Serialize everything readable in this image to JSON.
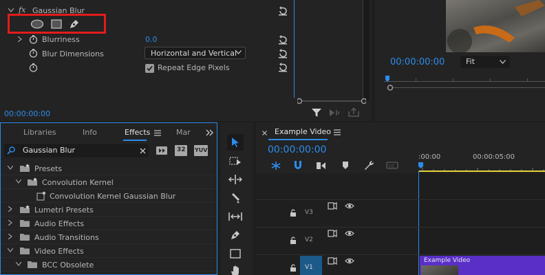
{
  "effect_controls": {
    "effect_name": "Gaussian Blur",
    "fx_label": "fx",
    "params": [
      {
        "label": "Blurriness",
        "value": "0.0"
      },
      {
        "label": "Blur Dimensions",
        "value": "Horizontal and Vertical"
      },
      {
        "label": "Repeat Edge Pixels"
      }
    ],
    "timecode": "00:00:00:00",
    "accent_color": "#2d8ceb",
    "highlight_color": "#e31c1c"
  },
  "program_monitor": {
    "timecode": "00:00:00:00",
    "fit_label": "Fit"
  },
  "effects_panel": {
    "tabs": [
      "Libraries",
      "Info",
      "Effects",
      "Mar"
    ],
    "active_tab": "Effects",
    "search_value": "Gaussian Blur",
    "filter_badges": [
      "32",
      "YUV"
    ],
    "tree": [
      {
        "label": "Presets",
        "level": 0,
        "expanded": true,
        "icon": "star-folder-icon"
      },
      {
        "label": "Convolution Kernel",
        "level": 1,
        "expanded": true,
        "icon": "star-folder-icon"
      },
      {
        "label": "Convolution Kernel Gaussian Blur",
        "level": 2,
        "icon": "preset-icon"
      },
      {
        "label": "Lumetri Presets",
        "level": 0,
        "expanded": false,
        "icon": "star-folder-icon"
      },
      {
        "label": "Audio Effects",
        "level": 0,
        "expanded": false,
        "icon": "folder-icon"
      },
      {
        "label": "Audio Transitions",
        "level": 0,
        "expanded": false,
        "icon": "folder-icon"
      },
      {
        "label": "Video Effects",
        "level": 0,
        "expanded": true,
        "icon": "folder-icon"
      },
      {
        "label": "BCC Obsolete",
        "level": 1,
        "expanded": true,
        "icon": "folder-icon"
      }
    ]
  },
  "timeline": {
    "sequence_name": "Example Video",
    "timecode": "00:00:00:00",
    "ruler_labels": [
      ":00:00",
      "00:00:05:00"
    ],
    "tracks": [
      "V3",
      "V2",
      "V1"
    ],
    "clip_label": "Example Video",
    "clip_color": "#5a2fc8"
  }
}
